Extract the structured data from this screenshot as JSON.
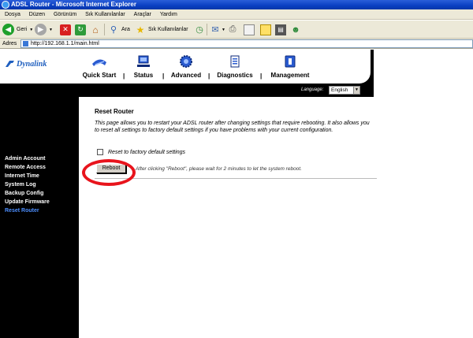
{
  "window": {
    "title": "ADSL Router - Microsoft Internet Explorer"
  },
  "menubar": {
    "items": [
      "Dosya",
      "Düzen",
      "Görünüm",
      "Sık Kullanılanlar",
      "Araçlar",
      "Yardım"
    ]
  },
  "toolbar": {
    "back_label": "Geri",
    "search_label": "Ara",
    "favorites_label": "Sık Kullanılanlar"
  },
  "address": {
    "label": "Adres",
    "url": "http://192.168.1.1/main.html"
  },
  "router": {
    "logo": "Dynalink",
    "nav": [
      "Quick Start",
      "Status",
      "Advanced",
      "Diagnostics",
      "Management"
    ],
    "nav_separator": "|",
    "language_label": "Language:",
    "language_value": "English",
    "sidebar": [
      "Admin Account",
      "Remote Access",
      "Internet Time",
      "System Log",
      "Backup Config",
      "Update Firmware",
      "Reset Router"
    ],
    "active_item": "Reset Router"
  },
  "content": {
    "title": "Reset Router",
    "description": "This page allows you to restart your ADSL router after changing settings that require rebooting. It also allows you to reset all settings to factory default settings if you have problems with your current configuration.",
    "checkbox_label": "Reset to factory default settings",
    "checkbox_checked": false,
    "reboot_label": "Reboot",
    "reboot_note": "After clicking \"Reboot\", please wait for 2 minutes to let the system reboot."
  },
  "colors": {
    "active_sidebar": "#4d8fff",
    "annotation_ring": "#e8141c",
    "logo": "#1f5fbf"
  }
}
